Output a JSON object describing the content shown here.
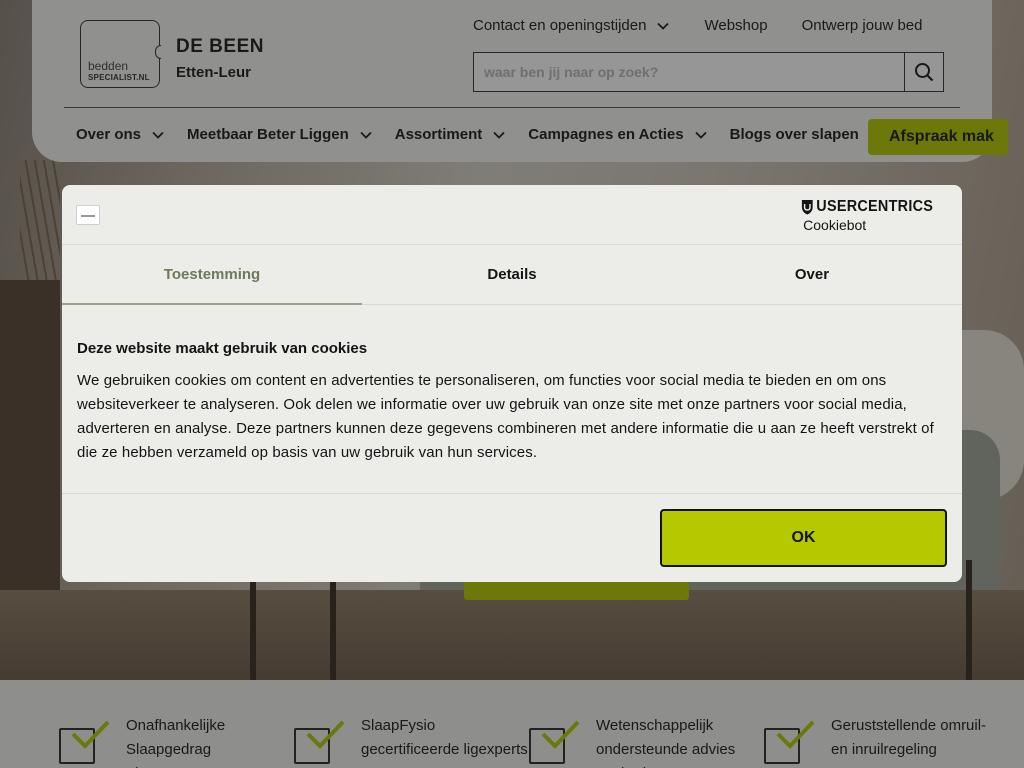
{
  "header": {
    "logo": {
      "line1": "bedden",
      "line2": "SPECIALIST.NL"
    },
    "store_name": "DE BEEN",
    "store_city": "Etten-Leur",
    "top_links": [
      {
        "label": "Contact en openingstijden",
        "has_dropdown": true
      },
      {
        "label": "Webshop",
        "has_dropdown": false
      },
      {
        "label": "Ontwerp jouw bed",
        "has_dropdown": false
      }
    ],
    "search": {
      "placeholder": "waar ben jij naar op zoek?",
      "value": ""
    },
    "nav": [
      {
        "label": "Over ons",
        "has_dropdown": true
      },
      {
        "label": "Meetbaar Beter Liggen",
        "has_dropdown": true
      },
      {
        "label": "Assortiment",
        "has_dropdown": true
      },
      {
        "label": "Campagnes en Acties",
        "has_dropdown": true
      },
      {
        "label": "Blogs over slapen",
        "has_dropdown": false
      }
    ],
    "appointment_button": "Afspraak mak"
  },
  "usps": [
    {
      "text": "Onafhankelijke Slaapgedrag Therapeuten"
    },
    {
      "text": "SlaapFysio gecertificeerde ligexperts"
    },
    {
      "text": "Wetenschappelijk ondersteunde advies methode"
    },
    {
      "text": "Geruststellende omruil- en inruilregeling"
    }
  ],
  "cookie_dialog": {
    "brand": {
      "name": "USERCENTRICS",
      "product": "Cookiebot"
    },
    "tabs": [
      {
        "label": "Toestemming",
        "active": true
      },
      {
        "label": "Details",
        "active": false
      },
      {
        "label": "Over",
        "active": false
      }
    ],
    "heading": "Deze website maakt gebruik van cookies",
    "body": "We gebruiken cookies om content en advertenties te personaliseren, om functies voor social media te bieden en om ons websiteverkeer te analyseren. Ook delen we informatie over uw gebruik van onze site met onze partners voor social media, adverteren en analyse. Deze partners kunnen deze gegevens combineren met andere informatie die u aan ze heeft verstrekt of die ze hebben verzameld op basis van uw gebruik van hun services.",
    "ok_button": "OK"
  },
  "colors": {
    "accent": "#b5c800",
    "active_tab": "#6f7a5c",
    "dialog_bg": "#ecede8",
    "overlay": "rgba(20,22,20,0.45)"
  },
  "icons": {
    "search": "search-icon",
    "dropdown": "chevron-down-icon",
    "usp": "checkmark-icon",
    "brand": "usercentrics-shield-icon"
  }
}
